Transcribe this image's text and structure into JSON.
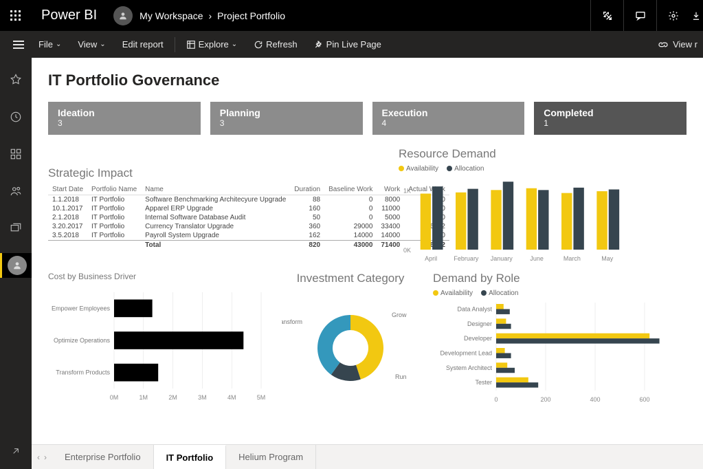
{
  "app": {
    "brand": "Power BI"
  },
  "breadcrumb": {
    "workspace": "My Workspace",
    "report": "Project Portfolio"
  },
  "menu": {
    "file": "File",
    "view": "View",
    "edit": "Edit report",
    "explore": "Explore",
    "refresh": "Refresh",
    "pin": "Pin Live Page",
    "viewR": "View r"
  },
  "report": {
    "title": "IT Portfolio Governance",
    "cards": [
      {
        "label": "Ideation",
        "value": "3"
      },
      {
        "label": "Planning",
        "value": "3"
      },
      {
        "label": "Execution",
        "value": "4"
      },
      {
        "label": "Completed",
        "value": "1"
      }
    ],
    "strategic": {
      "title": "Strategic Impact",
      "headers": [
        "Start Date",
        "Portfolio Name",
        "Name",
        "Duration",
        "Baseline Work",
        "Work",
        "Actual Work"
      ],
      "rows": [
        [
          "1.1.2018",
          "IT Portfolio",
          "Software Benchmarking Architecyure Upgrade",
          "88",
          "0",
          "8000",
          "0"
        ],
        [
          "10.1.2017",
          "IT Portfolio",
          "Apparel ERP Upgrade",
          "160",
          "0",
          "11000",
          "0"
        ],
        [
          "2.1.2018",
          "IT Portfolio",
          "Internal Software Database Audit",
          "50",
          "0",
          "5000",
          "0"
        ],
        [
          "3.20.2017",
          "IT Portfolio",
          "Currency Translator Upgrade",
          "360",
          "29000",
          "33400",
          "6012"
        ],
        [
          "3.5.2018",
          "IT Portfolio",
          "Payroll System Upgrade",
          "162",
          "14000",
          "14000",
          "0"
        ]
      ],
      "total": [
        "",
        "",
        "Total",
        "820",
        "43000",
        "71400",
        "6012"
      ]
    },
    "resource": {
      "title": "Resource Demand",
      "legend": {
        "a": "Availability",
        "b": "Allocation"
      }
    },
    "costBD": {
      "title": "Cost by Business Driver",
      "cats": [
        "Empower Employees",
        "Optimize Operations",
        "Transform Products"
      ],
      "xticks": [
        "0M",
        "1M",
        "2M",
        "3M",
        "4M",
        "5M"
      ]
    },
    "invest": {
      "title": "Investment Category",
      "labels": {
        "t": "Transform",
        "g": "Grow",
        "r": "Run"
      }
    },
    "demandRole": {
      "title": "Demand by Role",
      "legend": {
        "a": "Availability",
        "b": "Allocation"
      },
      "roles": [
        "Data Analyst",
        "Designer",
        "Developer",
        "Development Lead",
        "System Architect",
        "Tester"
      ],
      "xticks": [
        "0",
        "200",
        "400",
        "600"
      ]
    }
  },
  "tabs": [
    "Enterprise Portfolio",
    "IT Portfolio",
    "Helium Program"
  ],
  "chart_data": [
    {
      "type": "bar",
      "title": "Resource Demand",
      "categories": [
        "April",
        "February",
        "January",
        "June",
        "March",
        "May"
      ],
      "series": [
        {
          "name": "Availability",
          "values": [
            940,
            960,
            1000,
            1030,
            950,
            980
          ]
        },
        {
          "name": "Allocation",
          "values": [
            1060,
            1020,
            1140,
            1000,
            1040,
            1010
          ]
        }
      ],
      "ylim": [
        0,
        1200
      ],
      "yticks": [
        "0K",
        "1K"
      ]
    },
    {
      "type": "bar",
      "title": "Cost by Business Driver",
      "orientation": "h",
      "categories": [
        "Empower Employees",
        "Optimize Operations",
        "Transform Products"
      ],
      "values": [
        1300000,
        4400000,
        1500000
      ],
      "xlim": [
        0,
        5000000
      ],
      "xticks": [
        "0M",
        "1M",
        "2M",
        "3M",
        "4M",
        "5M"
      ]
    },
    {
      "type": "pie",
      "title": "Investment Category",
      "donut": true,
      "labels": [
        "Transform",
        "Grow",
        "Run"
      ],
      "values": [
        45,
        15,
        40
      ],
      "colors": [
        "#f2c811",
        "#36454f",
        "#3498bc"
      ]
    },
    {
      "type": "bar",
      "title": "Demand by Role",
      "orientation": "h",
      "categories": [
        "Data Analyst",
        "Designer",
        "Developer",
        "Development Lead",
        "System Architect",
        "Tester"
      ],
      "series": [
        {
          "name": "Availability",
          "values": [
            30,
            40,
            620,
            35,
            45,
            130
          ]
        },
        {
          "name": "Allocation",
          "values": [
            55,
            60,
            660,
            60,
            75,
            170
          ]
        }
      ],
      "xlim": [
        0,
        700
      ],
      "xticks": [
        "0",
        "200",
        "400",
        "600"
      ]
    }
  ]
}
